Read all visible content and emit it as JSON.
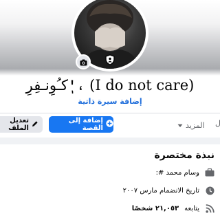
{
  "profile": {
    "name": "كـُوِنـفِرِ'ٖ، (I do not care)",
    "bio_link": "إضافة سيرة ذاتية"
  },
  "actions": {
    "add_story_label": "إضافة إلى القصة",
    "edit_profile_label": "تعديل الملف",
    "more_tab_label": "المزيد",
    "edge_tab_label": "ل"
  },
  "intro": {
    "title": "نبذة مختصرة",
    "work": "وسام محمد #:",
    "joined": "تاريخ الانضمام مارس ٢٠٠٧",
    "followers_prefix": "يتابعه",
    "followers_count": "٢١,٠٥٣ شخصًا"
  },
  "icons": {
    "camera": "camera-icon",
    "shield": "shield-icon",
    "plus": "plus-circle-icon",
    "pencil": "pencil-icon",
    "chevron": "chevron-down-icon",
    "briefcase": "briefcase-icon",
    "clock": "clock-icon",
    "feed": "rss-icon"
  },
  "colors": {
    "accent": "#1877f2",
    "link": "#216fdb",
    "muted": "#65676b"
  }
}
